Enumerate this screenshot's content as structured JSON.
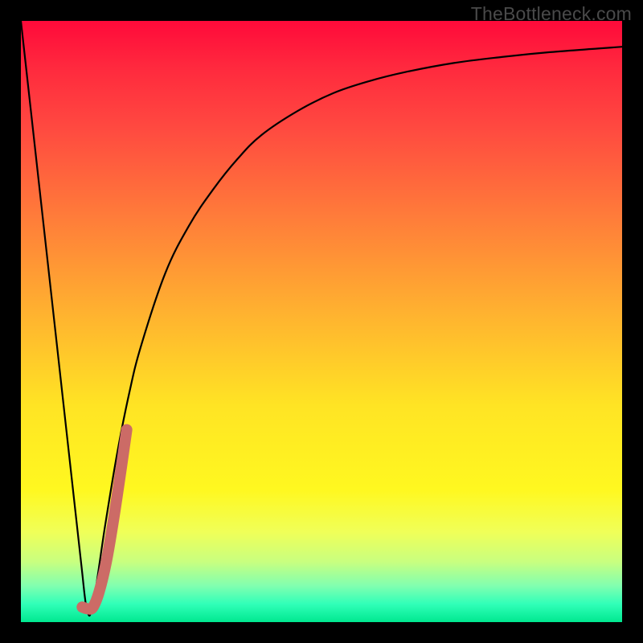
{
  "watermark": {
    "text": "TheBottleneck.com"
  },
  "colors": {
    "background": "#000000",
    "curve_main": "#000000",
    "curve_highlight": "#cc6b66"
  },
  "chart_data": {
    "type": "line",
    "title": "",
    "xlabel": "",
    "ylabel": "",
    "xlim": [
      0,
      100
    ],
    "ylim": [
      0,
      100
    ],
    "series": [
      {
        "name": "bottleneck-curve",
        "x": [
          0,
          2,
          4,
          6,
          8,
          10,
          11,
          12,
          14,
          16,
          18,
          20,
          24,
          28,
          32,
          36,
          40,
          46,
          52,
          58,
          64,
          72,
          80,
          88,
          96,
          100
        ],
        "values": [
          100,
          82,
          64,
          46,
          28,
          10,
          2,
          3,
          16,
          28,
          38,
          46,
          58,
          66,
          72,
          77,
          81,
          85,
          88,
          90,
          91.5,
          93,
          94,
          94.8,
          95.4,
          95.7
        ]
      },
      {
        "name": "highlight-curve",
        "x": [
          10.2,
          11.2,
          12.0,
          13.0,
          14.2,
          15.4,
          16.6,
          17.6
        ],
        "values": [
          2.5,
          2.2,
          2.5,
          5.0,
          10.0,
          17.0,
          25.0,
          32.0
        ]
      }
    ],
    "annotations": []
  }
}
